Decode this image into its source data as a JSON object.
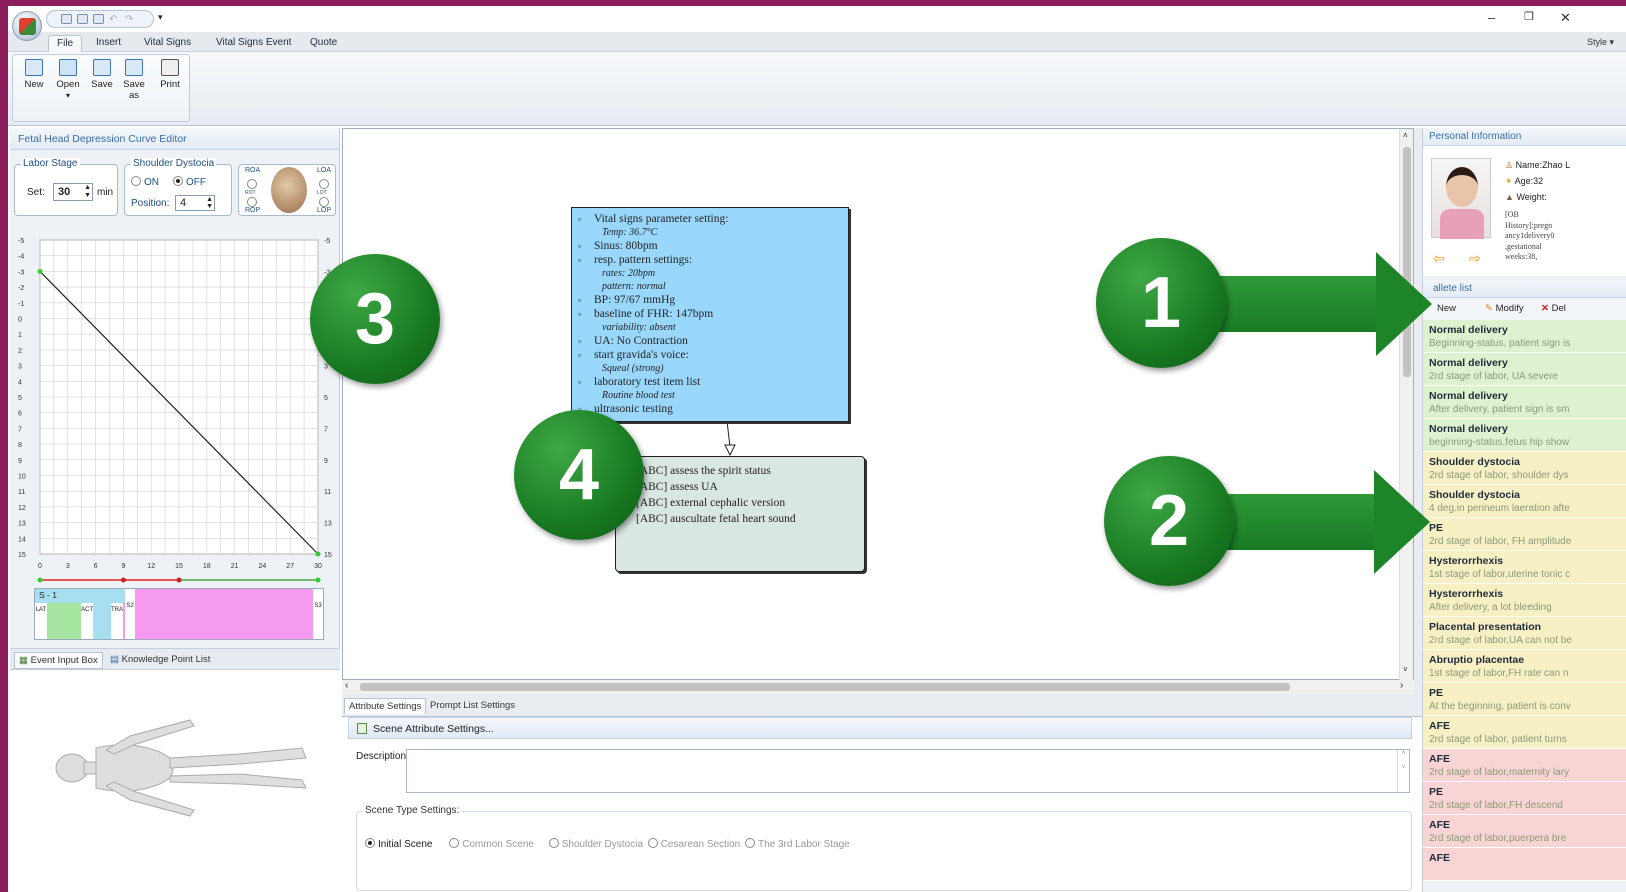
{
  "ribbon_tabs": [
    "File",
    "Insert",
    "Vital Signs",
    "Vital Signs Event",
    "Quote"
  ],
  "style_label": "Style",
  "ribbon_buttons": [
    "New",
    "Open",
    "Save",
    "Save as",
    "Print"
  ],
  "left_panel": {
    "title": "Fetal Head Depression Curve Editor",
    "labor_stage": {
      "legend": "Labor Stage",
      "set_label": "Set:",
      "value": "30",
      "unit": "min"
    },
    "shoulder_dystocia": {
      "legend": "Shoulder Dystocia",
      "on": "ON",
      "off": "OFF",
      "selected": "OFF",
      "position_label": "Position:",
      "position_value": "4"
    },
    "head_positions": [
      "ROA",
      "LOA",
      "ROT",
      "LOT",
      "ROP",
      "LOP"
    ],
    "stage_bar": {
      "label": "S - 1",
      "segments": [
        "LAT",
        "ACT",
        "TRA",
        "S2",
        "S3"
      ],
      "segment_colors": {
        "latent": "#a6e6a0",
        "active": "#a8dff0",
        "stage2": "#f59af0"
      }
    },
    "subtabs": [
      "Event Input Box",
      "Knowledge Point List"
    ]
  },
  "chart_data": {
    "type": "line",
    "title": "",
    "xlabel": "",
    "ylabel": "",
    "x_ticks": [
      0,
      3,
      6,
      9,
      12,
      15,
      18,
      21,
      24,
      27,
      30
    ],
    "y_ticks_left": [
      -5,
      -4,
      -3,
      -2,
      -1,
      0,
      1,
      2,
      3,
      4,
      5,
      6,
      7,
      8,
      9,
      10,
      11,
      12,
      13,
      14,
      15
    ],
    "y_ticks_right": [
      -5,
      -3,
      1,
      3,
      5,
      7,
      9,
      11,
      13,
      15
    ],
    "xlim": [
      0,
      30
    ],
    "ylim": [
      -5,
      15
    ],
    "grid": true,
    "series": [
      {
        "x": [
          0,
          30
        ],
        "y": [
          -3,
          15
        ]
      }
    ],
    "slider_markers": [
      0,
      9,
      15,
      30
    ]
  },
  "flow": {
    "node1": {
      "items": [
        {
          "text": "Vital signs parameter setting:",
          "sub": [
            "Temp: 36.7°C"
          ]
        },
        {
          "text": "Sinus: 80bpm",
          "sub": []
        },
        {
          "text": "resp. pattern settings:",
          "sub": [
            "rates: 20bpm",
            "pattern: normal"
          ]
        },
        {
          "text": "BP: 97/67  mmHg",
          "sub": []
        },
        {
          "text": "baseline of FHR:  147bpm",
          "sub": [
            "variability:  absent"
          ]
        },
        {
          "text": "UA: No Contraction",
          "sub": []
        },
        {
          "text": "start gravida's voice:",
          "sub": [
            "Squeal (strong)"
          ]
        },
        {
          "text": "laboratory test item list",
          "sub": [
            "Routine blood test"
          ]
        },
        {
          "text": "ultrasonic testing",
          "sub": []
        }
      ]
    },
    "node2": {
      "items": [
        "[ABC] assess the spirit status",
        "[ABC] assess UA",
        "[ABC] external cephalic version",
        "[ABC] auscultate fetal heart sound"
      ]
    }
  },
  "attributes": {
    "tabs": [
      "Attribute Settings",
      "Prompt List Settings"
    ],
    "header": "Scene Attribute Settings...",
    "description_label": "Description",
    "scene_type_legend": "Scene Type Settings:",
    "scene_types": [
      "Initial Scene",
      "Common Scene",
      "Shoulder Dystocia",
      "Cesarean Section",
      "The 3rd Labor Stage"
    ],
    "selected_scene_type": "Initial Scene"
  },
  "personal": {
    "title": "Personal Information",
    "name": "Name:Zhao L",
    "age": "Age:32",
    "weight": "Weight:",
    "history": [
      "[OB",
      "History]:pregn",
      "ancy1delivery0",
      ",gestational",
      "weeks:38,"
    ]
  },
  "palette": {
    "title": "allete list",
    "buttons": [
      "New",
      "Modify",
      "Del"
    ],
    "items": [
      {
        "title": "Normal delivery",
        "desc": "Beginning-status, patient sign is",
        "color": "#dff2cf"
      },
      {
        "title": "Normal delivery",
        "desc": "2rd stage of labor, UA severe",
        "color": "#dff2cf"
      },
      {
        "title": "Normal delivery",
        "desc": "After delivery, patient sign is sm",
        "color": "#dff2cf"
      },
      {
        "title": "Normal delivery",
        "desc": "beginning-status,fetus hip show",
        "color": "#dff2cf"
      },
      {
        "title": "Shoulder dystocia",
        "desc": "2rd stage of labor, shoulder dys",
        "color": "#f6f0c4"
      },
      {
        "title": "Shoulder dystocia",
        "desc": "4 deg.in perineum laeration afte",
        "color": "#f6f0c4"
      },
      {
        "title": "PE",
        "desc": "2rd stage of labor, FH amplitude",
        "color": "#f6f0c4"
      },
      {
        "title": "Hysterorrhexis",
        "desc": "1st stage of labor,uterine tonic c",
        "color": "#f6f0c4"
      },
      {
        "title": "Hysterorrhexis",
        "desc": "After delivery, a lot bleeding",
        "color": "#f6f0c4"
      },
      {
        "title": "Placental presentation",
        "desc": "2rd stage of labor,UA can not be",
        "color": "#f6f0c4"
      },
      {
        "title": "Abruptio placentae",
        "desc": "1st stage of labor,FH rate can n",
        "color": "#f6f0c4"
      },
      {
        "title": "PE",
        "desc": "At the beginning, patient is conv",
        "color": "#f6f0c4"
      },
      {
        "title": "AFE",
        "desc": "2rd stage of labor, patient turns",
        "color": "#f6f0c4"
      },
      {
        "title": "AFE",
        "desc": "2rd stage of labor,maternity lary",
        "color": "#f8d4d4"
      },
      {
        "title": "PE",
        "desc": "2rd stage of labor,FH descend",
        "color": "#f8d4d4"
      },
      {
        "title": "AFE",
        "desc": "2rd stage of labor,puerpera bre",
        "color": "#f8d4d4"
      },
      {
        "title": "AFE",
        "desc": "",
        "color": "#f8d4d4"
      }
    ]
  },
  "callouts": [
    "1",
    "2",
    "3",
    "4"
  ]
}
